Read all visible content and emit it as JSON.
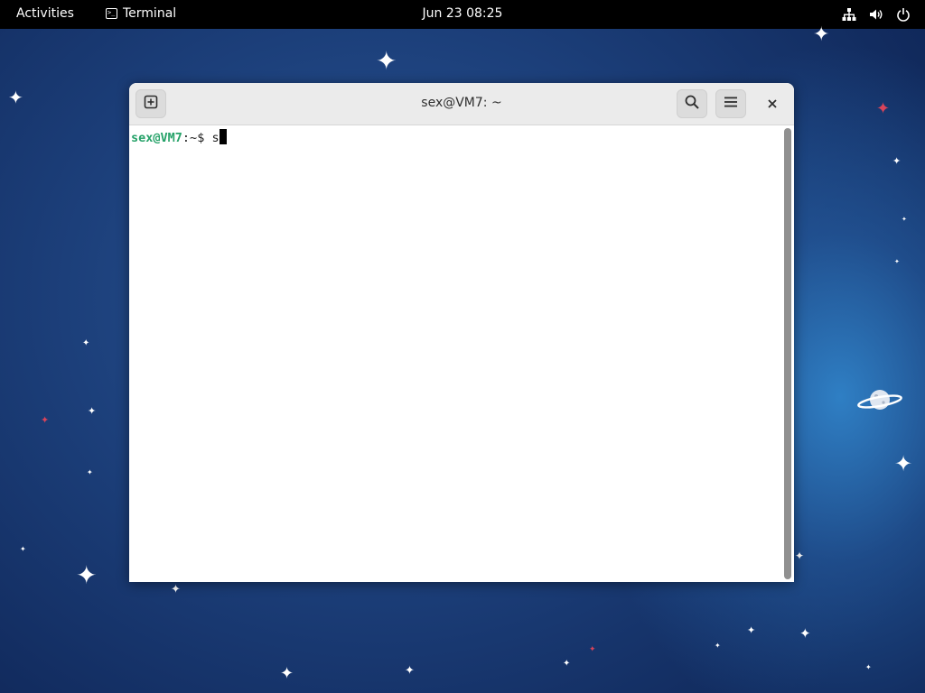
{
  "topbar": {
    "activities": "Activities",
    "app_name": "Terminal",
    "clock": "Jun 23  08:25",
    "tray_icons": [
      "network-icon",
      "volume-icon",
      "power-icon"
    ]
  },
  "window": {
    "title": "sex@VM7: ~",
    "buttons": [
      "new-tab-icon",
      "search-icon",
      "hamburger-menu-icon",
      "close-icon"
    ]
  },
  "terminal": {
    "prompt_user": "sex@VM7",
    "prompt_sep": ":",
    "prompt_path": "~",
    "prompt_symbol": "$ ",
    "typed_text": "s"
  },
  "colors": {
    "prompt_user": "#26a269",
    "topbar": "#000000",
    "desktop": "#1c3f7a"
  }
}
